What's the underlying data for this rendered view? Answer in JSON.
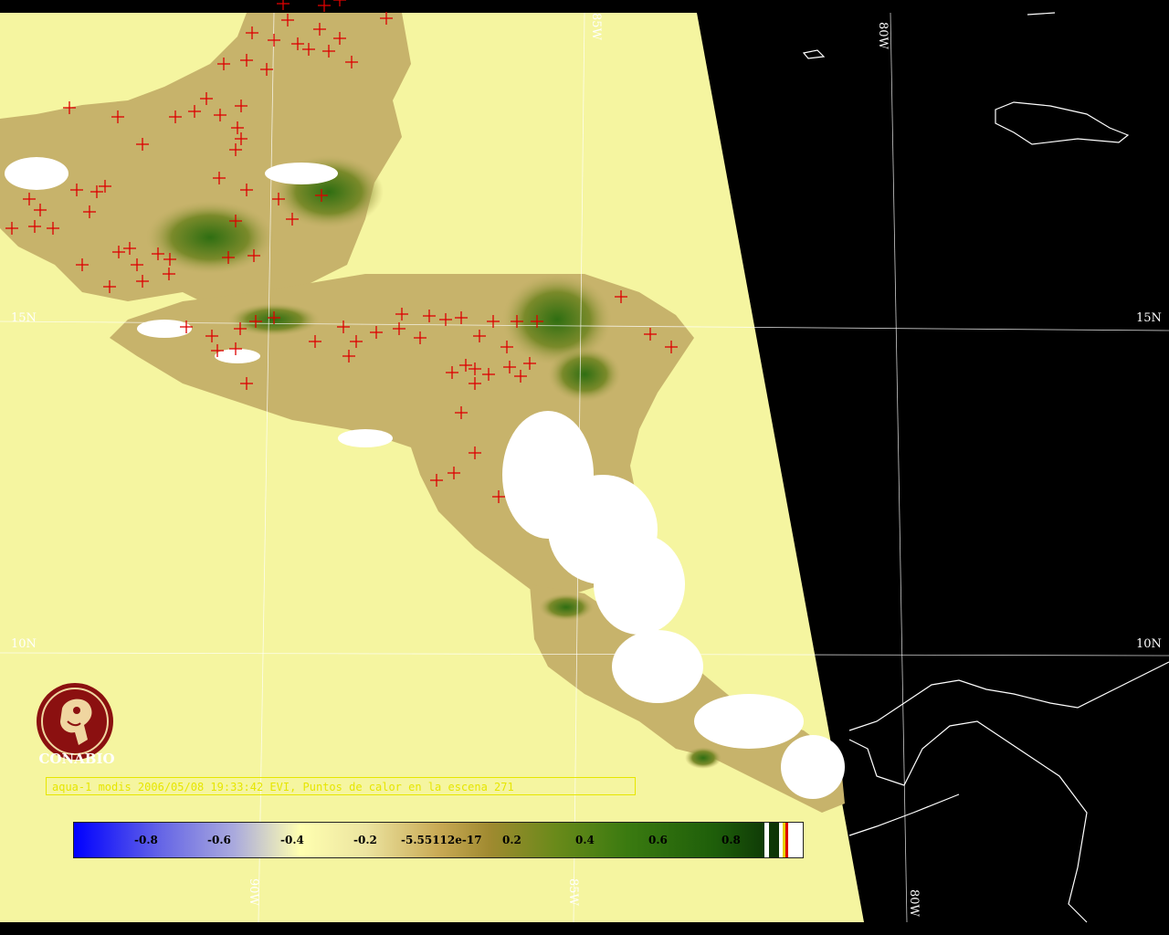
{
  "caption": "aqua-1 modis 2006/05/08 19:33:42 EVI, Puntos de calor en la escena 271",
  "logo": {
    "text": "CONABIO",
    "icon": "conabio-macaw-logo-icon"
  },
  "grid_labels": {
    "lat_15_left": "15N",
    "lat_15_right": "15N",
    "lat_10_left": "10N",
    "lat_10_right": "10N",
    "lon_85_top": "85W",
    "lon_80_top": "80W",
    "lon_90_bottom": "90W",
    "lon_85_bottom": "85W",
    "lon_80_bottom": "80W"
  },
  "colorbar": {
    "ticks": [
      "-0.8",
      "-0.6",
      "-0.4",
      "-0.2",
      "-5.55112e-17",
      "0.2",
      "0.4",
      "0.6",
      "0.8"
    ]
  },
  "colors": {
    "ocean_swath": "#f5f5a0",
    "outside_swath": "#000000",
    "cloud": "#ffffff",
    "hotspot": "#dd0000",
    "grid": "#ffffff",
    "caption": "#e6e600"
  }
}
